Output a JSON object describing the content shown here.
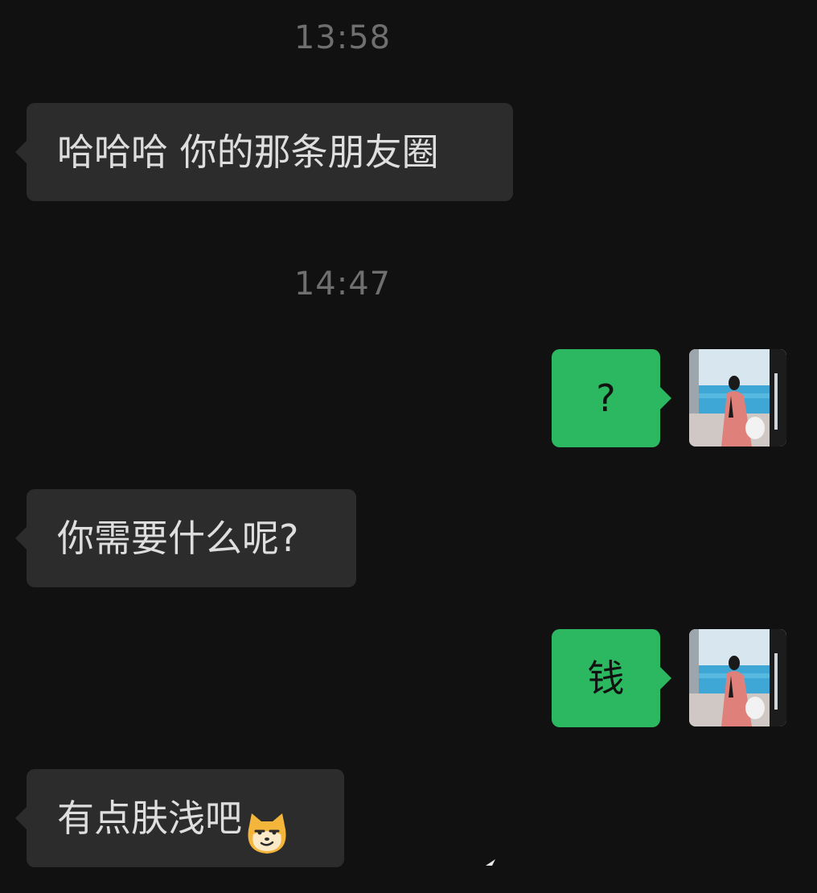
{
  "timestamps": {
    "first": "13:58",
    "second": "14:47"
  },
  "messages": [
    {
      "direction": "incoming",
      "text": "哈哈哈 你的那条朋友圈"
    },
    {
      "direction": "outgoing",
      "text": "?"
    },
    {
      "direction": "incoming",
      "text": "你需要什么呢?"
    },
    {
      "direction": "outgoing",
      "text": "钱"
    },
    {
      "direction": "incoming",
      "text": "有点肤浅吧",
      "emoji": "smug-cat-emoji"
    }
  ],
  "colors": {
    "background": "#111111",
    "incoming_bubble": "#2c2c2c",
    "outgoing_bubble": "#2cb861",
    "timestamp": "#6f6f6f"
  },
  "icons": {
    "avatar": "user-avatar-photo",
    "emoji": "smug-cat-emoji"
  }
}
